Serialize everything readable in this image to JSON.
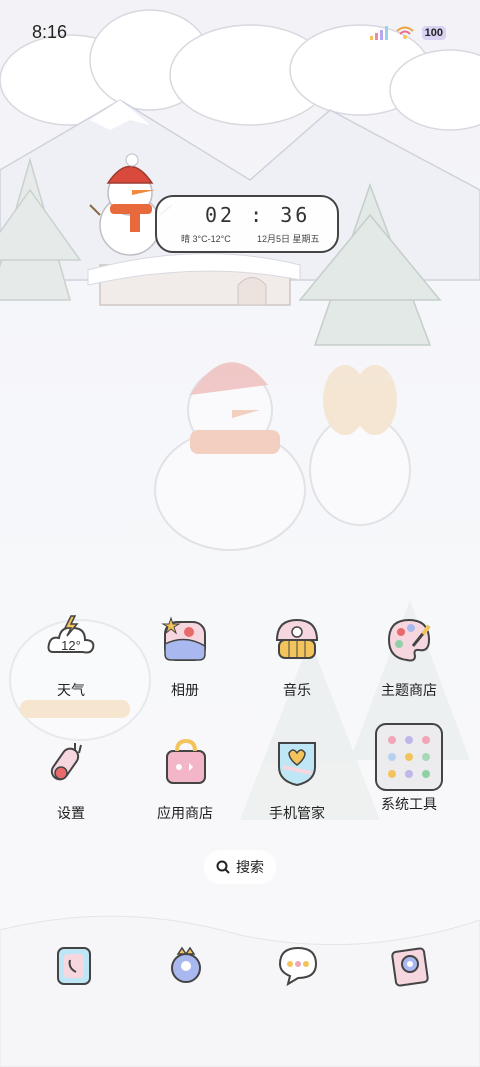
{
  "status_bar": {
    "time": "8:16",
    "battery": "100"
  },
  "widget": {
    "time": "02 : 36",
    "weather": "晴 3°C-12°C",
    "date": "12月5日 星期五"
  },
  "apps": [
    {
      "label": "天气",
      "badge": "12°",
      "icon": "weather-icon"
    },
    {
      "label": "相册",
      "icon": "gallery-icon"
    },
    {
      "label": "音乐",
      "icon": "music-icon"
    },
    {
      "label": "主题商店",
      "icon": "theme-store-icon"
    },
    {
      "label": "设置",
      "icon": "settings-icon"
    },
    {
      "label": "应用商店",
      "icon": "app-store-icon"
    },
    {
      "label": "手机管家",
      "icon": "phone-manager-icon"
    },
    {
      "label": "系统工具",
      "icon": "system-tools-folder-icon"
    }
  ],
  "search": {
    "label": "搜索",
    "icon": "search-icon"
  },
  "dock": [
    {
      "icon": "phone-icon"
    },
    {
      "icon": "contacts-icon"
    },
    {
      "icon": "messages-icon"
    },
    {
      "icon": "camera-icon"
    }
  ],
  "colors": {
    "accent": "#e8a6b8",
    "snowman_scarf": "#e86a3c",
    "hat_red": "#d94a3c"
  }
}
